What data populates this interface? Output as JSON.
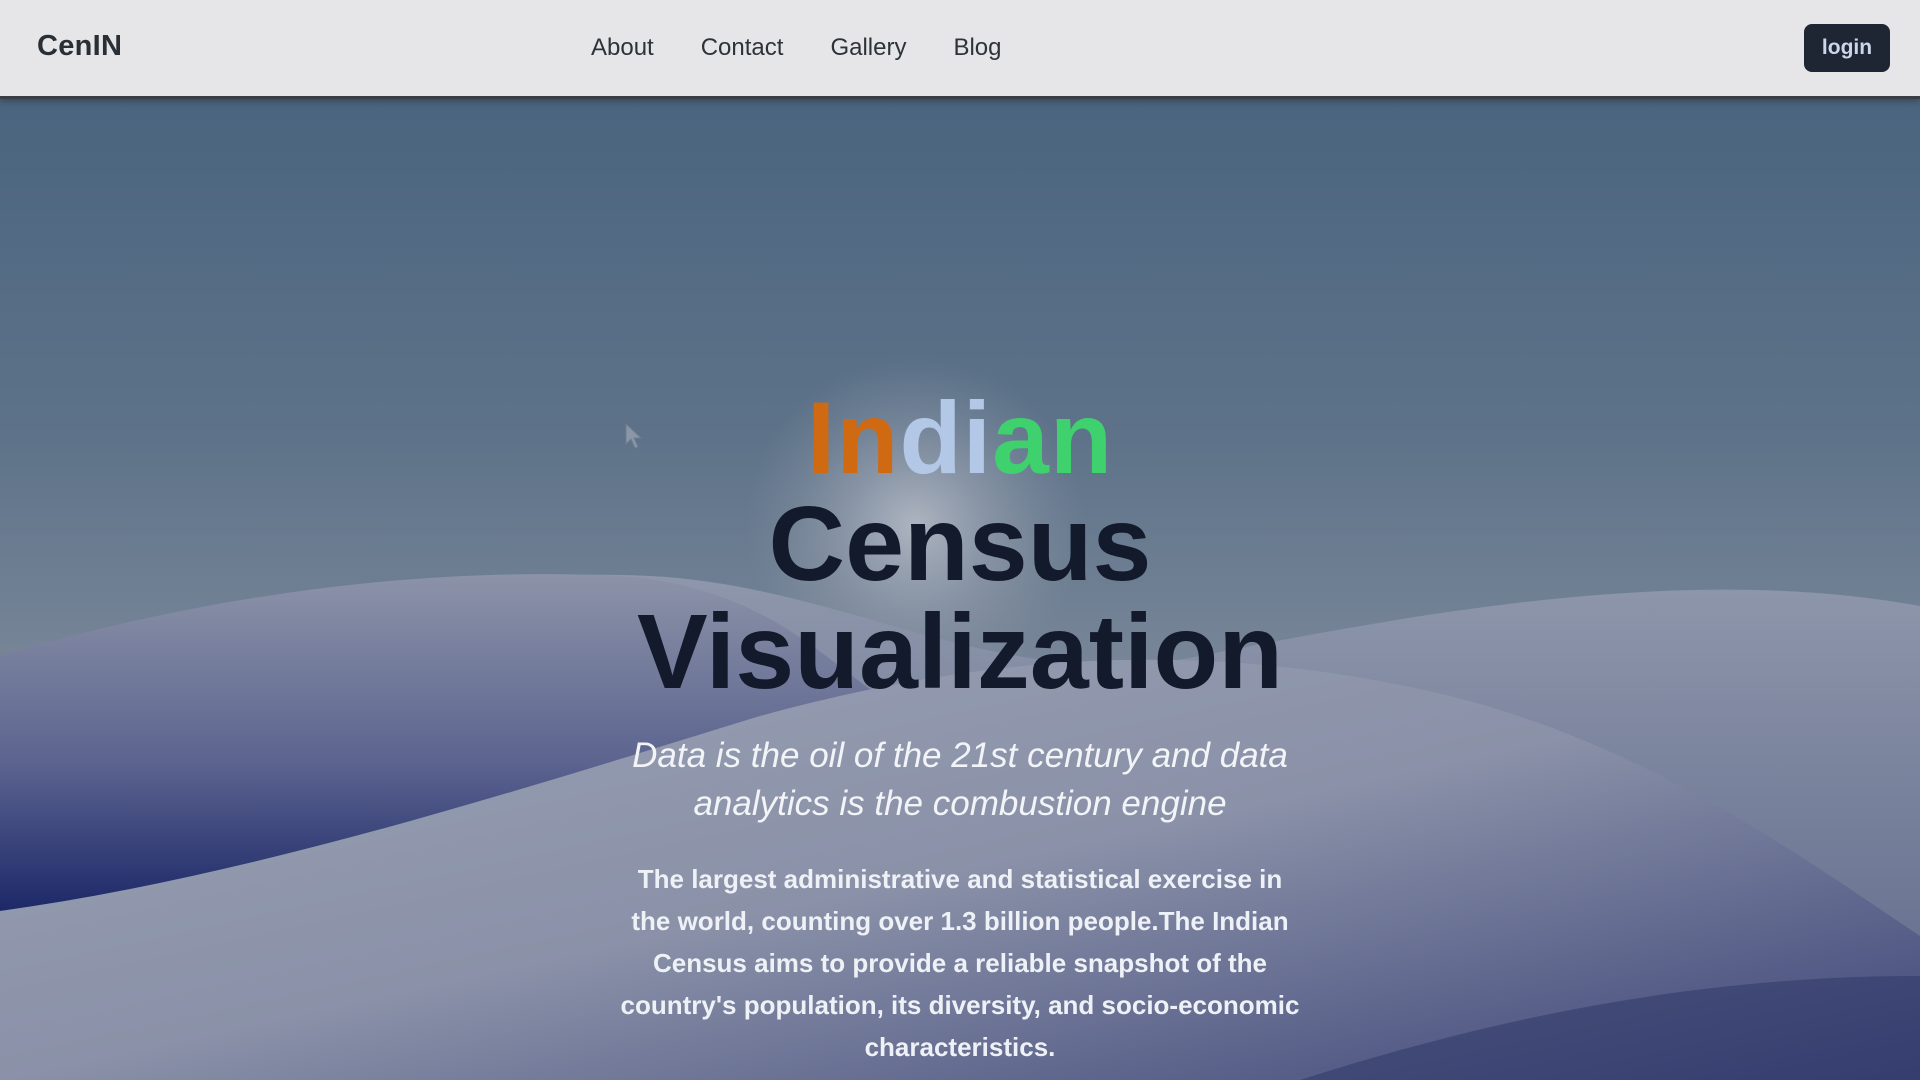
{
  "nav": {
    "brand": "CenIN",
    "links": [
      "About",
      "Contact",
      "Gallery",
      "Blog"
    ],
    "login_label": "login"
  },
  "hero": {
    "title_word_parts": [
      "In",
      "di",
      "an"
    ],
    "title_line2": "Census",
    "title_line3": "Visualization",
    "tagline": "Data is the oil of the 21st century and data analytics is the combustion engine",
    "description": "The largest administrative and statistical exercise in the world, counting over 1.3 billion people.The Indian Census aims to provide a reliable snapshot of the country's population, its diversity, and socio-economic characteristics."
  },
  "colors": {
    "saffron": "#cf6a12",
    "white_part": "#b3c7e6",
    "green": "#3fd16e",
    "title_dark": "#121a2c",
    "login_bg": "#1e2533"
  },
  "icons": {
    "cursor": "mouse-pointer-icon"
  }
}
